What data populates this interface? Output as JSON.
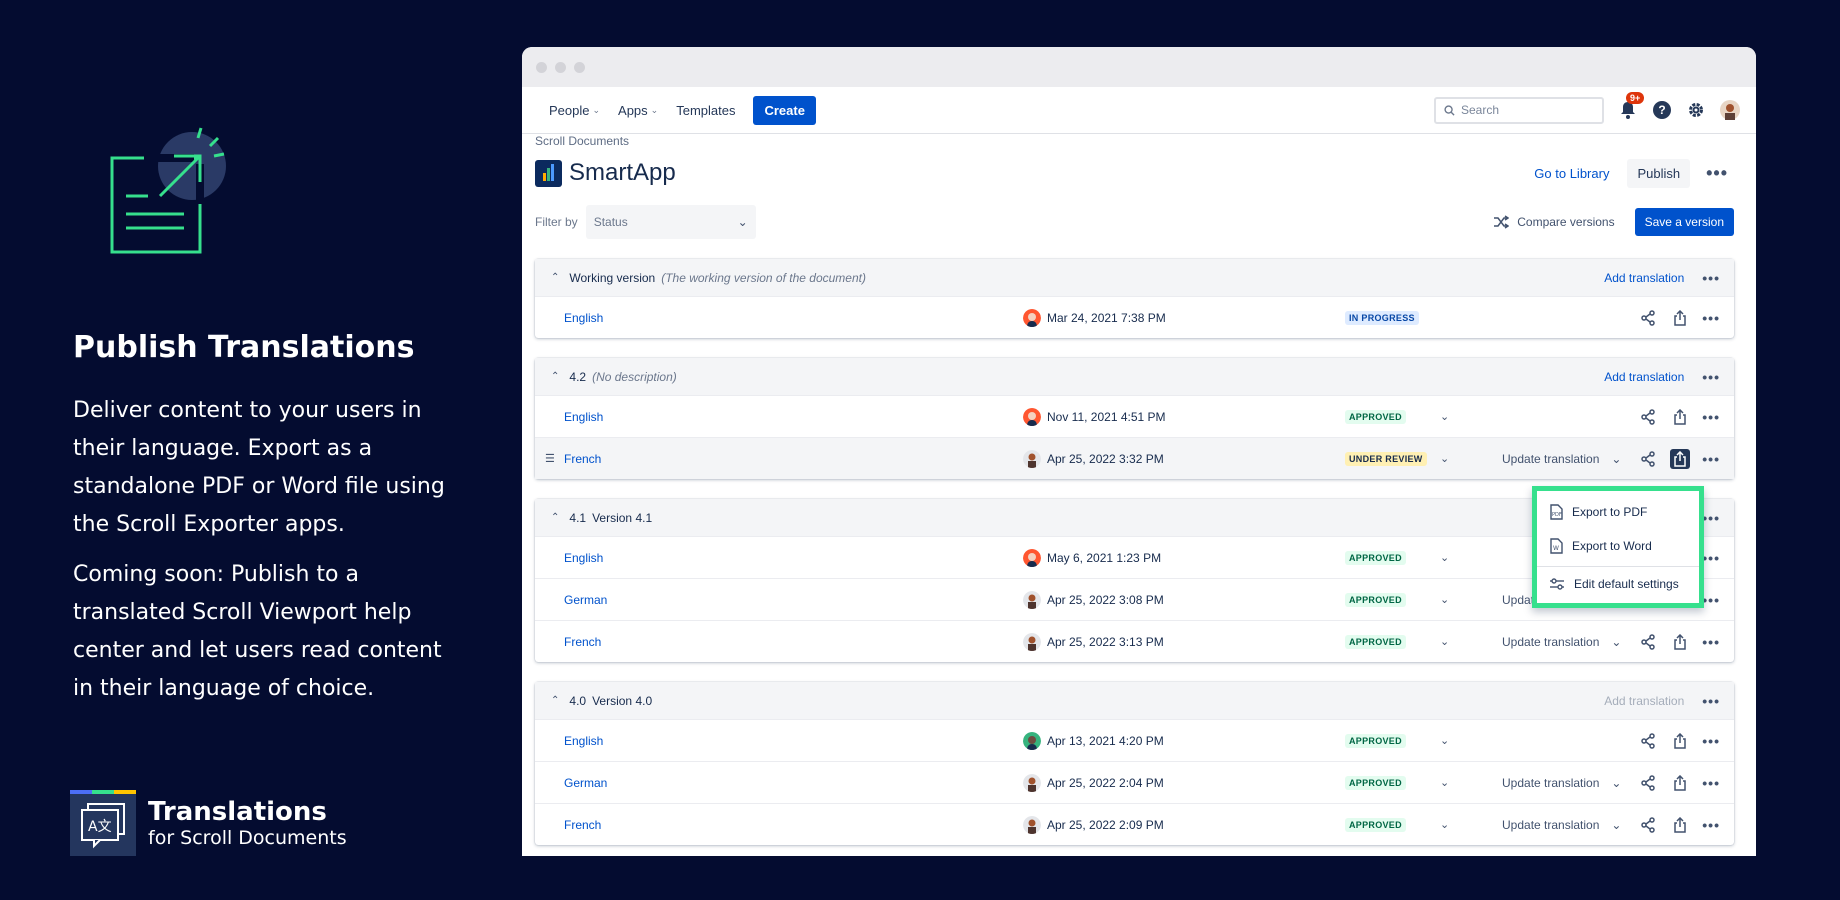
{
  "hero": {
    "title": "Publish Translations",
    "paragraph1": "Deliver content to your users in their language. Export as a standalone PDF or Word file using the Scroll Exporter apps.",
    "paragraph2": "Coming soon: Publish to a translated Scroll Viewport help center and let users read content in their language of choice."
  },
  "brand": {
    "name": "Translations",
    "subtitle": "for Scroll Documents"
  },
  "nav": {
    "items": [
      "People",
      "Apps",
      "Templates"
    ],
    "create_label": "Create",
    "search_placeholder": "Search",
    "notification_badge": "9+",
    "help_glyph": "?"
  },
  "page": {
    "breadcrumb": "Scroll Documents",
    "title": "SmartApp",
    "go_to_library": "Go to Library",
    "publish": "Publish",
    "filter_label": "Filter by",
    "filter_value": "Status",
    "compare_label": "Compare versions",
    "save_label": "Save a version"
  },
  "groups": [
    {
      "name": "Working version",
      "desc": "(The working version of the document)",
      "desc_italic": true,
      "add_label": "Add translation",
      "add_disabled": false,
      "rows": [
        {
          "lang": "English",
          "date": "Mar 24, 2021 7:38 PM",
          "status": "IN PROGRESS",
          "status_kind": "progress",
          "update": ""
        }
      ]
    },
    {
      "name": "4.2",
      "desc": "(No description)",
      "desc_italic": true,
      "add_label": "Add translation",
      "add_disabled": false,
      "rows": [
        {
          "lang": "English",
          "date": "Nov 11, 2021 4:51 PM",
          "status": "APPROVED",
          "status_kind": "approved",
          "update": ""
        },
        {
          "lang": "French",
          "date": "Apr 25, 2022 3:32 PM",
          "status": "UNDER REVIEW",
          "status_kind": "review",
          "update": "Update translation"
        }
      ]
    },
    {
      "name": "4.1",
      "desc": "Version 4.1",
      "desc_italic": false,
      "add_label": "",
      "add_disabled": false,
      "rows": [
        {
          "lang": "English",
          "date": "May 6, 2021 1:23 PM",
          "status": "APPROVED",
          "status_kind": "approved",
          "update": ""
        },
        {
          "lang": "German",
          "date": "Apr 25, 2022 3:08 PM",
          "status": "APPROVED",
          "status_kind": "approved",
          "update": "Update translation"
        },
        {
          "lang": "French",
          "date": "Apr 25, 2022 3:13 PM",
          "status": "APPROVED",
          "status_kind": "approved",
          "update": "Update translation"
        }
      ]
    },
    {
      "name": "4.0",
      "desc": "Version 4.0",
      "desc_italic": false,
      "add_label": "Add translation",
      "add_disabled": true,
      "rows": [
        {
          "lang": "English",
          "date": "Apr 13, 2021 4:20 PM",
          "status": "APPROVED",
          "status_kind": "approved",
          "update": ""
        },
        {
          "lang": "German",
          "date": "Apr 25, 2022 2:04 PM",
          "status": "APPROVED",
          "status_kind": "approved",
          "update": "Update translation"
        },
        {
          "lang": "French",
          "date": "Apr 25, 2022 2:09 PM",
          "status": "APPROVED",
          "status_kind": "approved",
          "update": "Update translation"
        }
      ]
    }
  ],
  "export_menu": [
    "Export to PDF",
    "Export to Word",
    "Edit default settings"
  ],
  "colors": {
    "accent": "#0052cc",
    "highlight": "#36e08d",
    "background": "#040c30"
  }
}
